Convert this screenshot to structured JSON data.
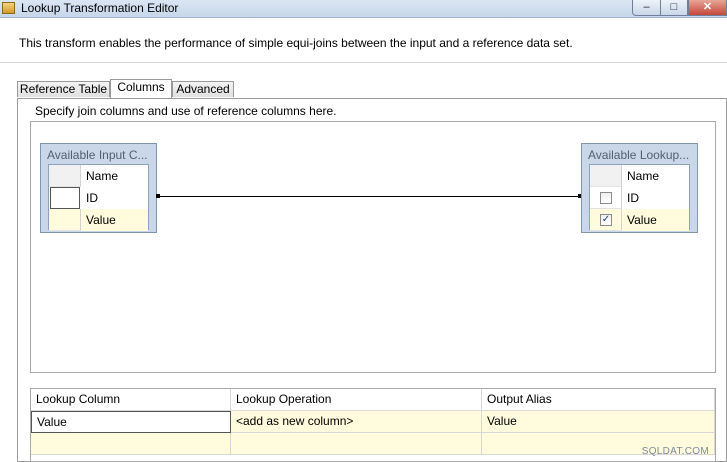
{
  "window": {
    "title": "Lookup Transformation Editor",
    "minimize": "–",
    "maximize": "□",
    "close": "✕"
  },
  "description": "This transform enables the performance of simple equi-joins between the input and a reference data set.",
  "tabs": [
    {
      "label": "Reference Table",
      "active": false
    },
    {
      "label": "Columns",
      "active": true
    },
    {
      "label": "Advanced",
      "active": false
    }
  ],
  "columns_tab": {
    "hint": "Specify join columns and use of reference columns here.",
    "input_table": {
      "caption": "Available Input C...",
      "header": "Name",
      "rows": [
        "ID",
        "Value"
      ]
    },
    "lookup_table": {
      "caption": "Available Lookup...",
      "header": "Name",
      "rows": [
        {
          "name": "ID",
          "checked": false
        },
        {
          "name": "Value",
          "checked": true
        }
      ]
    },
    "mapping_grid": {
      "headers": [
        "Lookup Column",
        "Lookup Operation",
        "Output Alias"
      ],
      "rows": [
        [
          "Value",
          "<add as new column>",
          "Value"
        ]
      ]
    }
  },
  "watermark": "SQLDAT.COM",
  "colors": {
    "table_header_bg": "#c9d7e9",
    "selected_row_bg": "#fffbdc"
  }
}
